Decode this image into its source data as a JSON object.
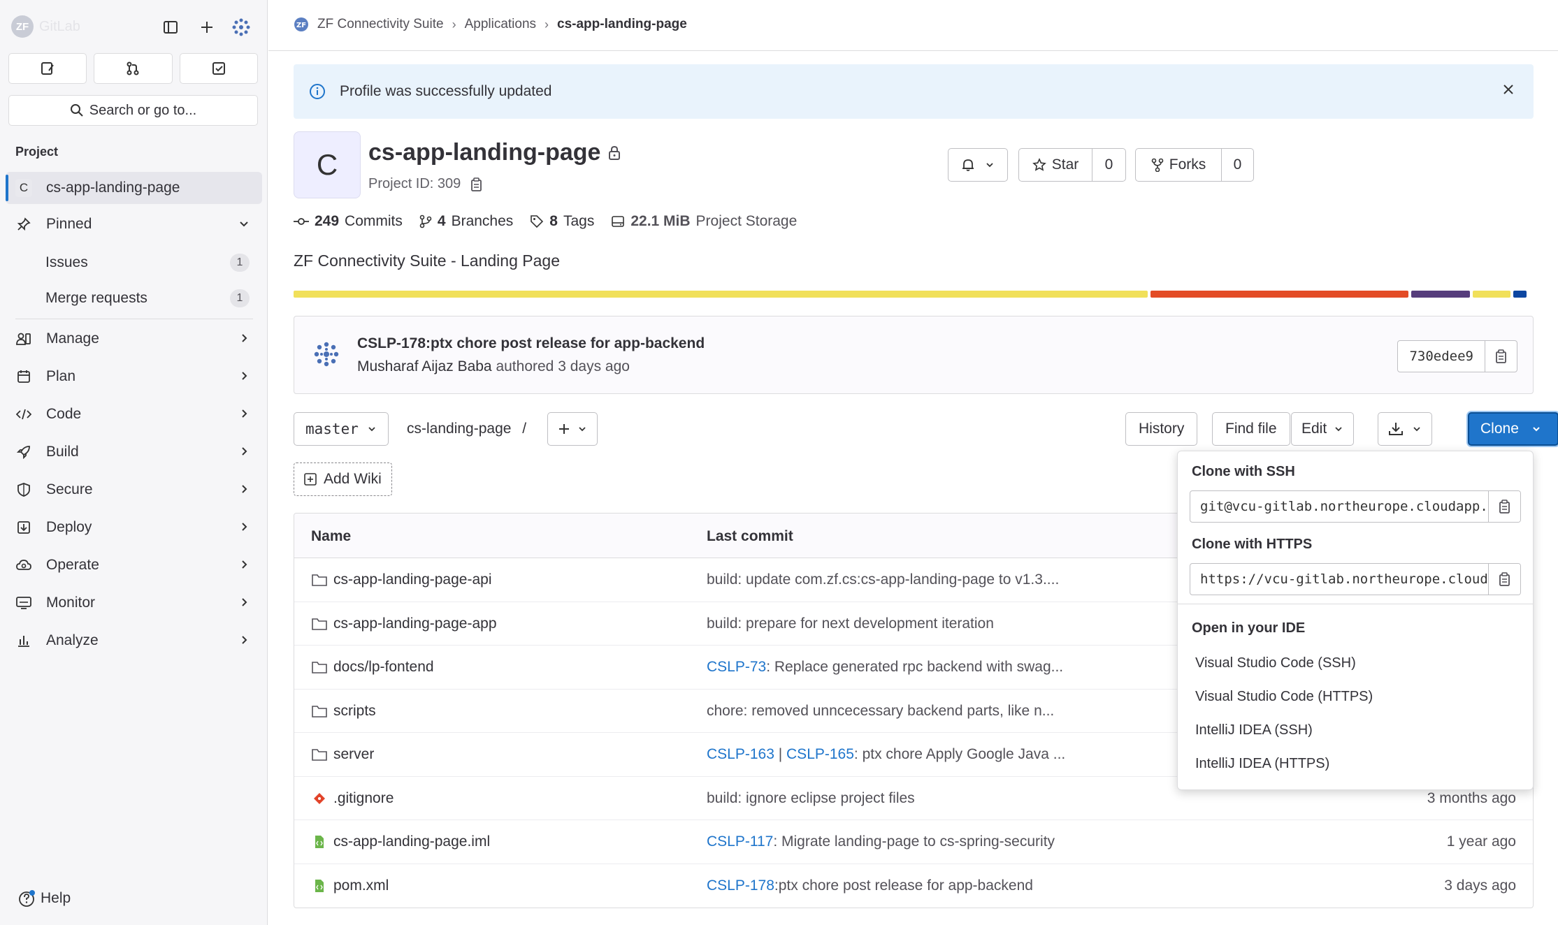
{
  "sidebar": {
    "logo_text": "GitLab",
    "logo_letters": "ZF",
    "search_label": "Search or go to...",
    "section_label": "Project",
    "project_letter": "C",
    "project_name": "cs-app-landing-page",
    "pinned_label": "Pinned",
    "pinned_items": [
      {
        "label": "Issues",
        "count": "1"
      },
      {
        "label": "Merge requests",
        "count": "1"
      }
    ],
    "menu": [
      {
        "label": "Manage",
        "icon": "users-icon"
      },
      {
        "label": "Plan",
        "icon": "calendar-icon"
      },
      {
        "label": "Code",
        "icon": "code-icon"
      },
      {
        "label": "Build",
        "icon": "rocket-icon"
      },
      {
        "label": "Secure",
        "icon": "shield-icon"
      },
      {
        "label": "Deploy",
        "icon": "deploy-icon"
      },
      {
        "label": "Operate",
        "icon": "cloud-gear-icon"
      },
      {
        "label": "Monitor",
        "icon": "monitor-icon"
      },
      {
        "label": "Analyze",
        "icon": "chart-icon"
      }
    ],
    "help_label": "Help"
  },
  "breadcrumb": {
    "group": "ZF Connectivity Suite",
    "section": "Applications",
    "current": "cs-app-landing-page"
  },
  "alert": {
    "message": "Profile was successfully updated"
  },
  "project": {
    "letter": "C",
    "name": "cs-app-landing-page",
    "id_label": "Project ID: 309",
    "star_label": "Star",
    "star_count": "0",
    "forks_label": "Forks",
    "forks_count": "0",
    "description": "ZF Connectivity Suite - Landing Page"
  },
  "stats": {
    "commits_num": "249",
    "commits_label": "Commits",
    "branches_num": "4",
    "branches_label": "Branches",
    "tags_num": "8",
    "tags_label": "Tags",
    "storage_num": "22.1 MiB",
    "storage_label": "Project Storage"
  },
  "languages": [
    {
      "color": "#f1e05a",
      "share": 0.695
    },
    {
      "color": "#e34c26",
      "share": 0.21
    },
    {
      "color": "#563d7c",
      "share": 0.048
    },
    {
      "color": "#f1e05a",
      "share": 0.031
    },
    {
      "color": "#0d47a1",
      "share": 0.011
    }
  ],
  "last_commit": {
    "title": "CSLP-178:ptx chore post release for app-backend",
    "author": "Musharaf Aijaz Baba",
    "meta": "authored 3 days ago",
    "sha": "730edee9"
  },
  "repo_bar": {
    "branch": "master",
    "path": "cs-landing-page",
    "path_sep": "/",
    "history": "History",
    "find_file": "Find file",
    "edit": "Edit",
    "clone": "Clone",
    "add_wiki": "Add Wiki"
  },
  "table": {
    "col_name": "Name",
    "col_commit": "Last commit",
    "rows": [
      {
        "name": "cs-app-landing-page-api",
        "type": "folder",
        "commit_link": "",
        "commit": "build: update com.zf.cs:cs-app-landing-page to v1.3....",
        "time": ""
      },
      {
        "name": "cs-app-landing-page-app",
        "type": "folder",
        "commit_link": "",
        "commit": "build: prepare for next development iteration",
        "time": ""
      },
      {
        "name": "docs/lp-fontend",
        "type": "folder",
        "commit_link": "CSLP-73",
        "commit": ": Replace generated rpc backend with swag...",
        "time": ""
      },
      {
        "name": "scripts",
        "type": "folder",
        "commit_link": "",
        "commit": "chore: removed unncecessary backend parts, like n...",
        "time": ""
      },
      {
        "name": "server",
        "type": "folder",
        "commit_link": "CSLP-163",
        "commit_link2": "CSLP-165",
        "commit": ": ptx chore Apply Google Java ...",
        "time": ""
      },
      {
        "name": ".gitignore",
        "type": "git",
        "commit_link": "",
        "commit": "build: ignore eclipse project files",
        "time": "3 months ago"
      },
      {
        "name": "cs-app-landing-page.iml",
        "type": "file",
        "commit_link": "CSLP-117",
        "commit": ": Migrate landing-page to cs-spring-security",
        "time": "1 year ago"
      },
      {
        "name": "pom.xml",
        "type": "file",
        "commit_link": "CSLP-178",
        "commit": ":ptx chore post release for app-backend",
        "time": "3 days ago"
      }
    ]
  },
  "clone_dropdown": {
    "ssh_label": "Clone with SSH",
    "ssh_value": "git@vcu-gitlab.northeurope.cloudapp.azure.com",
    "https_label": "Clone with HTTPS",
    "https_value": "https://vcu-gitlab.northeurope.cloudapp.azure.com",
    "ide_label": "Open in your IDE",
    "ide_items": [
      "Visual Studio Code (SSH)",
      "Visual Studio Code (HTTPS)",
      "IntelliJ IDEA (SSH)",
      "IntelliJ IDEA (HTTPS)"
    ]
  }
}
